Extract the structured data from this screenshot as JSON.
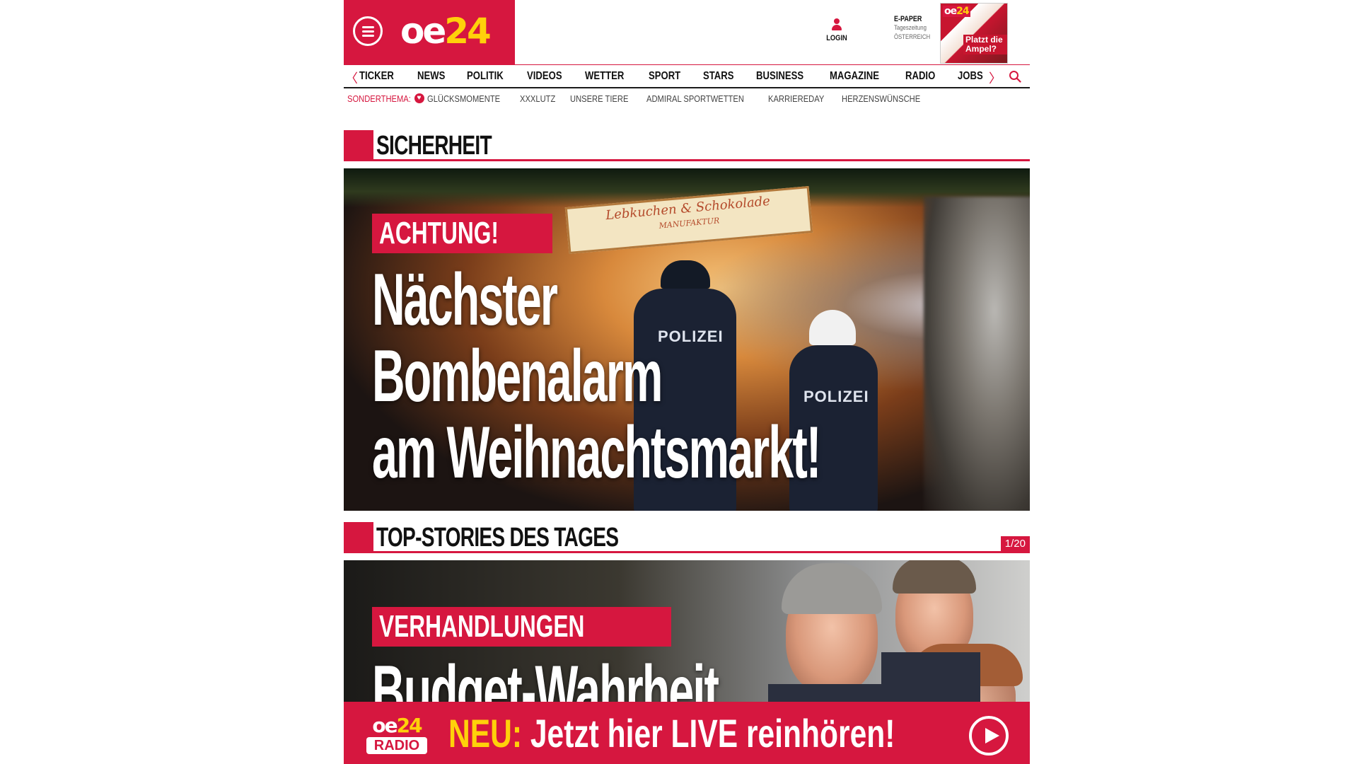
{
  "header": {
    "logo": {
      "part1": "oe",
      "part2": "24"
    },
    "login_label": "LOGIN",
    "epaper": {
      "title": "E-PAPER",
      "line1": "Tageszeitung",
      "line2": "ÖSTERREICH"
    },
    "epaper_thumb": {
      "logo_part1": "oe",
      "logo_part2": "24",
      "headline": "Platzt die Ampel?"
    }
  },
  "nav": {
    "items": [
      "TICKER",
      "NEWS",
      "POLITIK",
      "VIDEOS",
      "WETTER",
      "SPORT",
      "STARS",
      "BUSINESS",
      "MAGAZINE",
      "RADIO",
      "JOBS"
    ],
    "left_arrow": "〈",
    "right_arrow": "〉"
  },
  "subnav": {
    "label": "SONDERTHEMA:",
    "items": [
      "GLÜCKSMOMENTE",
      "XXXLUTZ",
      "UNSERE TIERE",
      "ADMIRAL SPORTWETTEN",
      "KARRIEREDAY",
      "HERZENSWÜNSCHE"
    ]
  },
  "section1": {
    "title": "SICHERHEIT",
    "story": {
      "kicker": "ACHTUNG!",
      "headline_lines": [
        "Nächster",
        "Bombenalarm",
        "am Weihnachtsmarkt!"
      ],
      "image": {
        "sign_line1": "Lebkuchen & Schokolade",
        "sign_line2": "MANUFAKTUR",
        "badge": "POLIZEI"
      }
    }
  },
  "section2": {
    "title": "TOP-STORIES DES TAGES",
    "counter": "1/20",
    "story": {
      "kicker": "VERHANDLUNGEN",
      "headline": "Budget-Wahrheit"
    }
  },
  "radio_banner": {
    "logo_part1": "oe",
    "logo_part2": "24",
    "logo_radio": "RADIO",
    "neu": "NEU:",
    "text": " Jetzt hier LIVE reinhören!"
  },
  "colors": {
    "brand_red": "#d6173f",
    "brand_yellow": "#ffd10a",
    "text_dark": "#111111"
  },
  "icons": [
    "menu-icon",
    "user-icon",
    "chevron-left-icon",
    "chevron-right-icon",
    "search-icon",
    "play-icon",
    "heart-icon"
  ]
}
